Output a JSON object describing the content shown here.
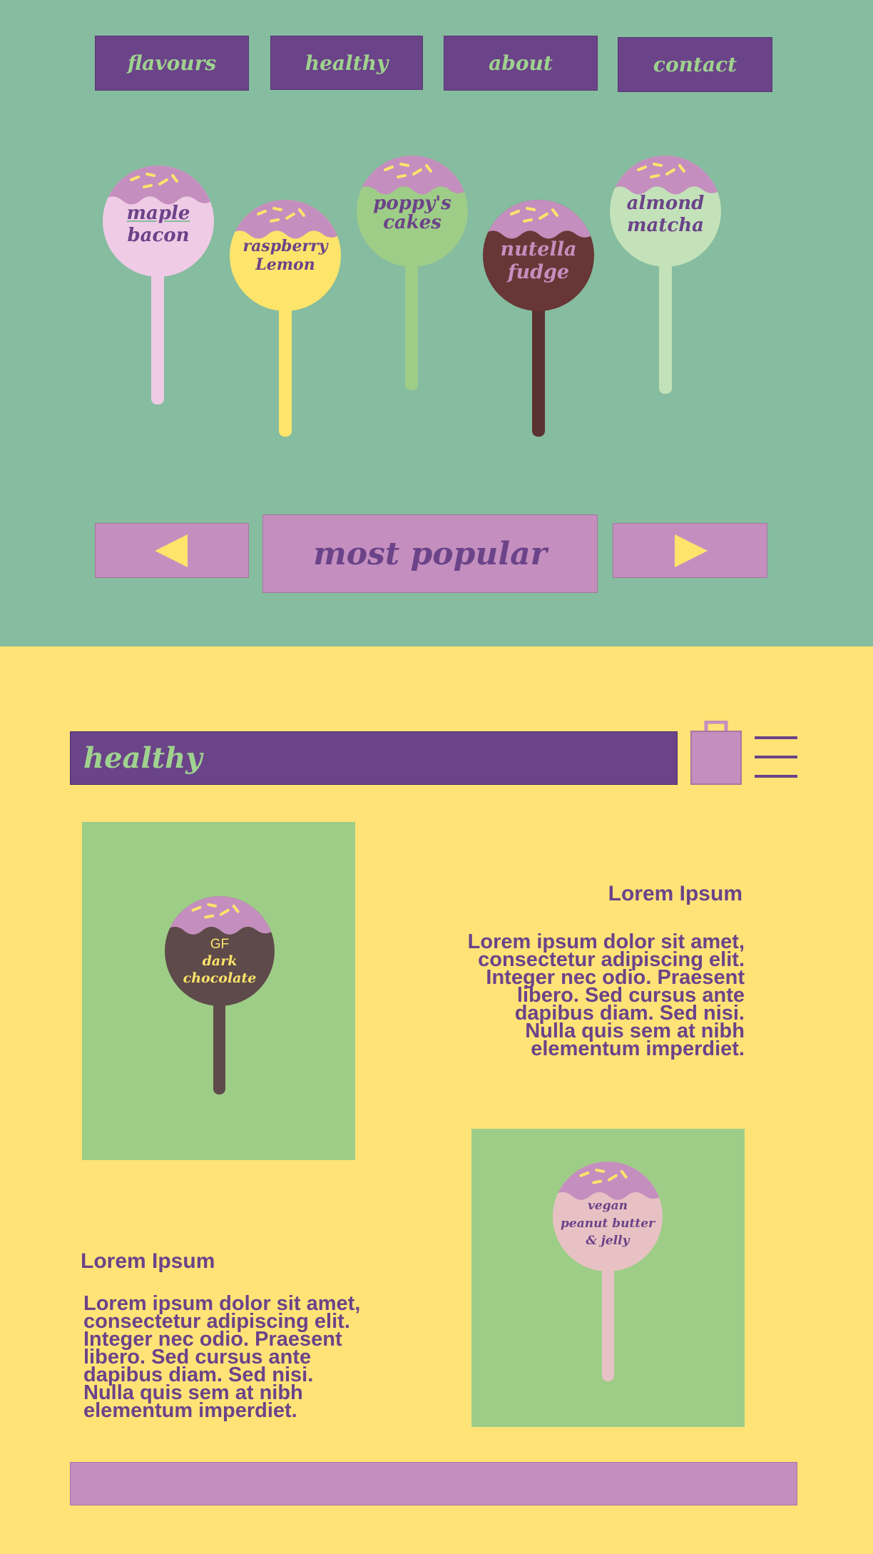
{
  "nav": {
    "items": [
      {
        "label": "flavours"
      },
      {
        "label": "healthy"
      },
      {
        "label": "about"
      },
      {
        "label": "contact"
      }
    ]
  },
  "carousel": {
    "pops": [
      {
        "label_line1": "maple",
        "label_line2": "bacon",
        "color": "#f0cbe6"
      },
      {
        "label_line1": "raspberry",
        "label_line2": "Lemon",
        "color": "#fde46b"
      },
      {
        "label_line1": "poppy's",
        "label_line2": "cakes",
        "color": "#9ecd87"
      },
      {
        "label_line1": "nutella",
        "label_line2": "fudge",
        "color": "#683636"
      },
      {
        "label_line1": "almond",
        "label_line2": "matcha",
        "color": "#c3e2b9"
      }
    ],
    "title": "most popular",
    "prev_icon": "triangle-left-icon",
    "next_icon": "triangle-right-icon"
  },
  "healthy": {
    "title": "healthy",
    "cart_icon": "shopping-bag-icon",
    "menu_icon": "hamburger-menu-icon"
  },
  "products": [
    {
      "line1": "GF",
      "line2": "dark",
      "line3": "chocolate",
      "color": "#5e4a4a"
    },
    {
      "line1": "vegan",
      "line2": "peanut butter",
      "line3": "& jelly",
      "color": "#e8c1c4"
    }
  ],
  "sections": [
    {
      "heading": "Lorem Ipsum",
      "lines": [
        "Lorem ipsum dolor sit amet,",
        "consectetur adipiscing elit.",
        "Integer nec odio. Praesent",
        "libero. Sed cursus ante",
        "dapibus diam. Sed nisi.",
        "Nulla quis sem at nibh",
        "elementum imperdiet."
      ]
    },
    {
      "heading": "Lorem Ipsum",
      "lines": [
        "Lorem ipsum dolor sit amet,",
        "consectetur adipiscing elit.",
        "Integer nec odio. Praesent",
        "libero. Sed cursus ante",
        "dapibus diam. Sed nisi.",
        "Nulla quis sem at nibh",
        "elementum imperdiet."
      ]
    }
  ],
  "colors": {
    "accent_purple": "#6b4389",
    "mint": "#86bc9f",
    "yellow": "#ffe377",
    "pink_purple": "#c48fbe",
    "green": "#9ecd87"
  }
}
